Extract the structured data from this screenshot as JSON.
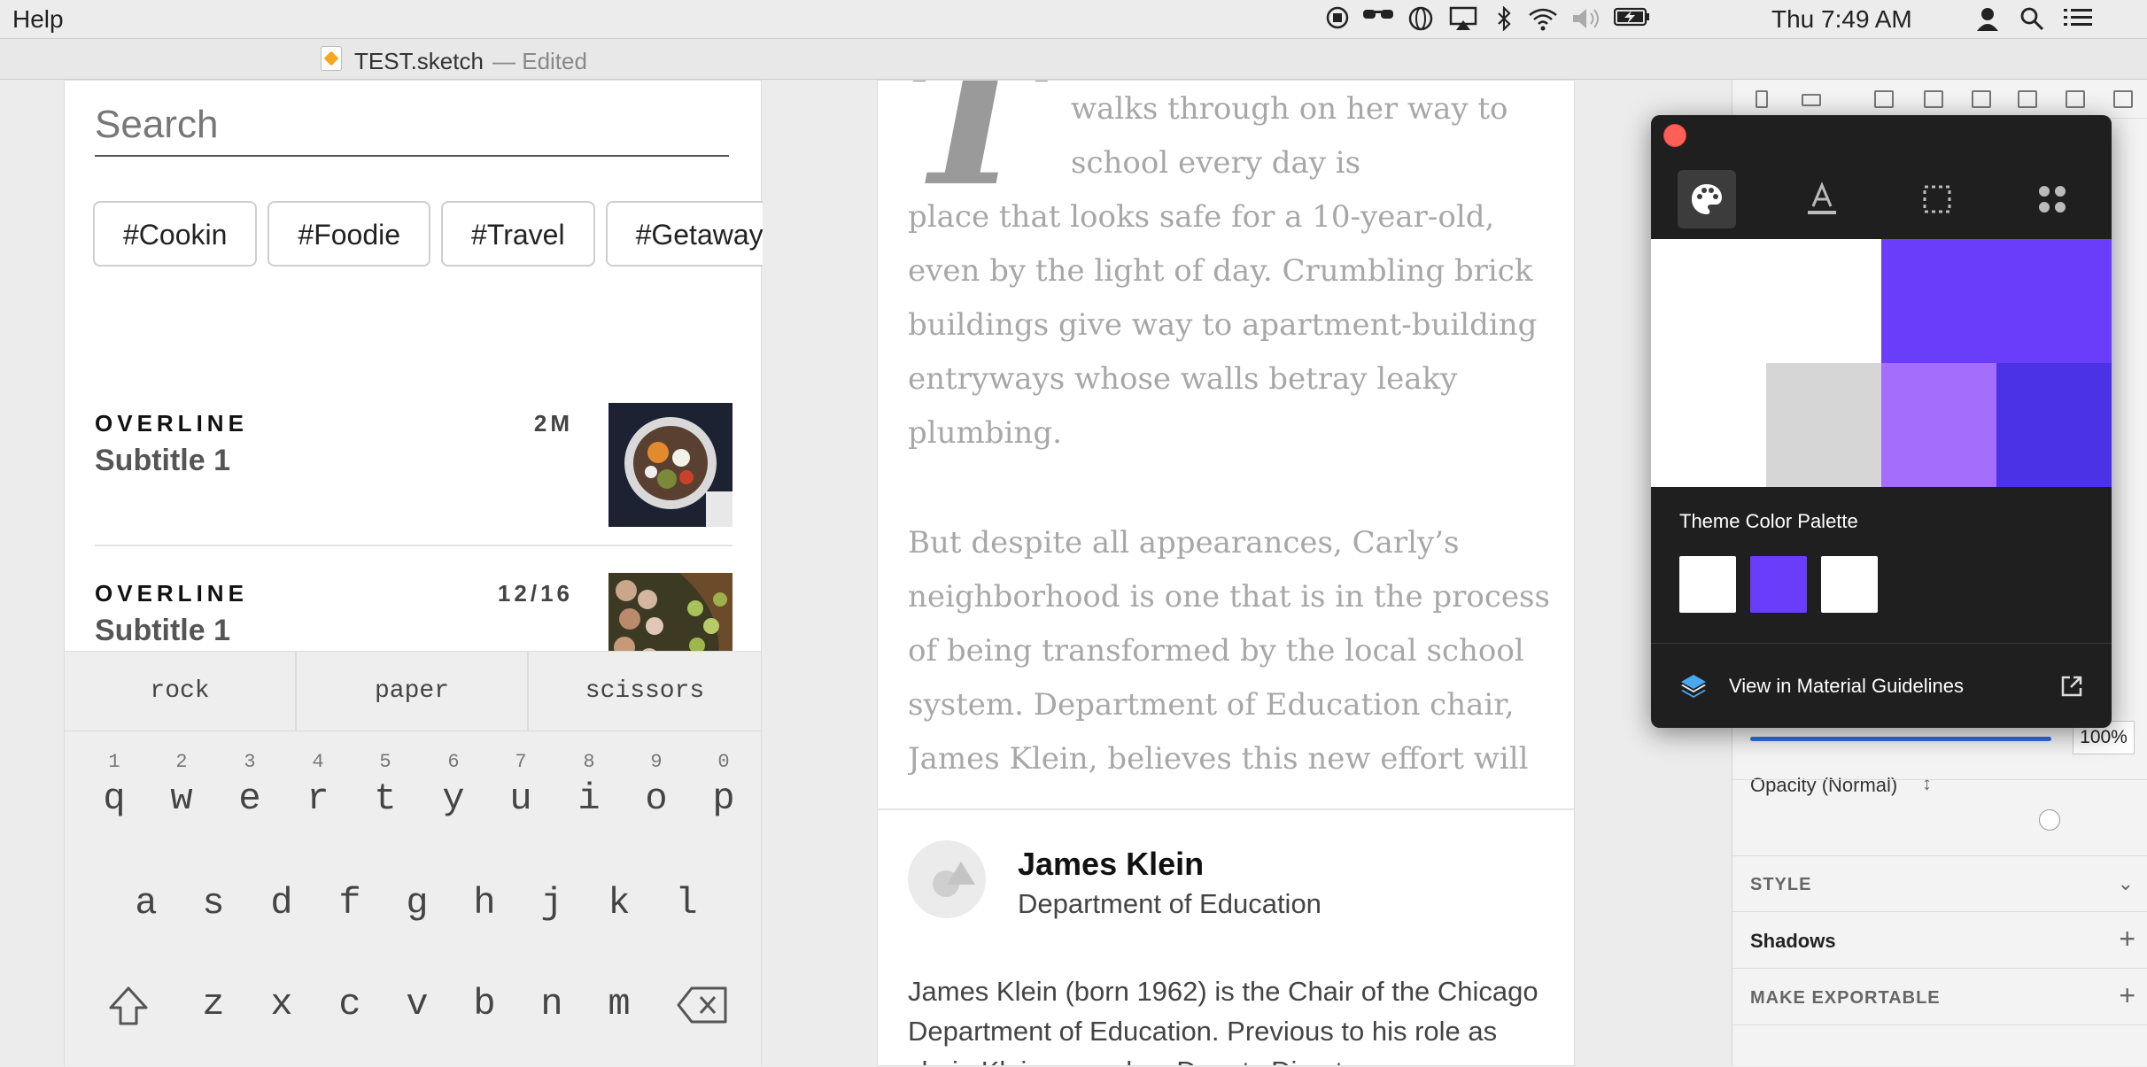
{
  "menubar": {
    "help_label": "Help",
    "clock": "Thu 7:49 AM",
    "icons": [
      "record-icon",
      "glasses-icon",
      "globe-icon",
      "airplay-icon",
      "bluetooth-icon",
      "wifi-icon",
      "volume-icon",
      "battery-icon",
      "user-icon",
      "spotlight-icon",
      "menu-icon"
    ]
  },
  "window": {
    "filename": "TEST.sketch",
    "status": "— Edited"
  },
  "search_screen": {
    "search_placeholder": "Search",
    "chips": [
      "#Cookin",
      "#Foodie",
      "#Travel",
      "#Getaway"
    ],
    "items": [
      {
        "overline": "OVERLINE",
        "meta": "2M",
        "subtitle": "Subtitle 1"
      },
      {
        "overline": "OVERLINE",
        "meta": "12/16",
        "subtitle": "Subtitle 1"
      }
    ],
    "suggestions": [
      "rock",
      "paper",
      "scissors"
    ],
    "keys_row1": [
      {
        "num": "1",
        "ch": "q"
      },
      {
        "num": "2",
        "ch": "w"
      },
      {
        "num": "3",
        "ch": "e"
      },
      {
        "num": "4",
        "ch": "r"
      },
      {
        "num": "5",
        "ch": "t"
      },
      {
        "num": "6",
        "ch": "y"
      },
      {
        "num": "7",
        "ch": "u"
      },
      {
        "num": "8",
        "ch": "i"
      },
      {
        "num": "9",
        "ch": "o"
      },
      {
        "num": "0",
        "ch": "p"
      }
    ],
    "keys_row2": [
      "a",
      "s",
      "d",
      "f",
      "g",
      "h",
      "j",
      "k",
      "l"
    ],
    "keys_row3": [
      "z",
      "x",
      "c",
      "v",
      "b",
      "n",
      "m"
    ]
  },
  "article": {
    "dropcap": "T",
    "lead_lines": [
      "walks through on her way to",
      "school every day is"
    ],
    "para1": "place that looks safe for a 10-year-old, even by the light of day. Crumbling brick buildings give way to apartment-building entryways whose walls betray leaky plumbing.",
    "para2": "But despite all appearances, Carly’s neighborhood is one that is in the process of being transformed by the local school system. Department of Education chair, James Klein,  believes this new effort will change the way of life for its",
    "author_name": "James Klein",
    "author_dept": "Department of Education",
    "bio": "James Klein (born 1962) is the Chair of the Chicago Department of Education. Previous to his role as chair, Klein served as Deputy Director"
  },
  "popup": {
    "tabs": [
      "palette-icon",
      "text-style-icon",
      "shape-icon",
      "components-icon"
    ],
    "colors": {
      "white": "#ffffff",
      "primary": "#6a3dfb",
      "grey": "#d6d6d6",
      "light_primary": "#a46dfb",
      "dark_primary": "#4b32e6"
    },
    "palette_label": "Theme Color Palette",
    "palette": [
      "#ffffff",
      "#6a3dfb",
      "#ffffff"
    ],
    "guidelines_label": "View in Material Guidelines"
  },
  "inspector": {
    "opacity_label": "Opacity (Normal)",
    "opacity_value": "100%",
    "opacity": 1.0,
    "style_label": "STYLE",
    "shadows_label": "Shadows",
    "export_label": "MAKE EXPORTABLE"
  }
}
